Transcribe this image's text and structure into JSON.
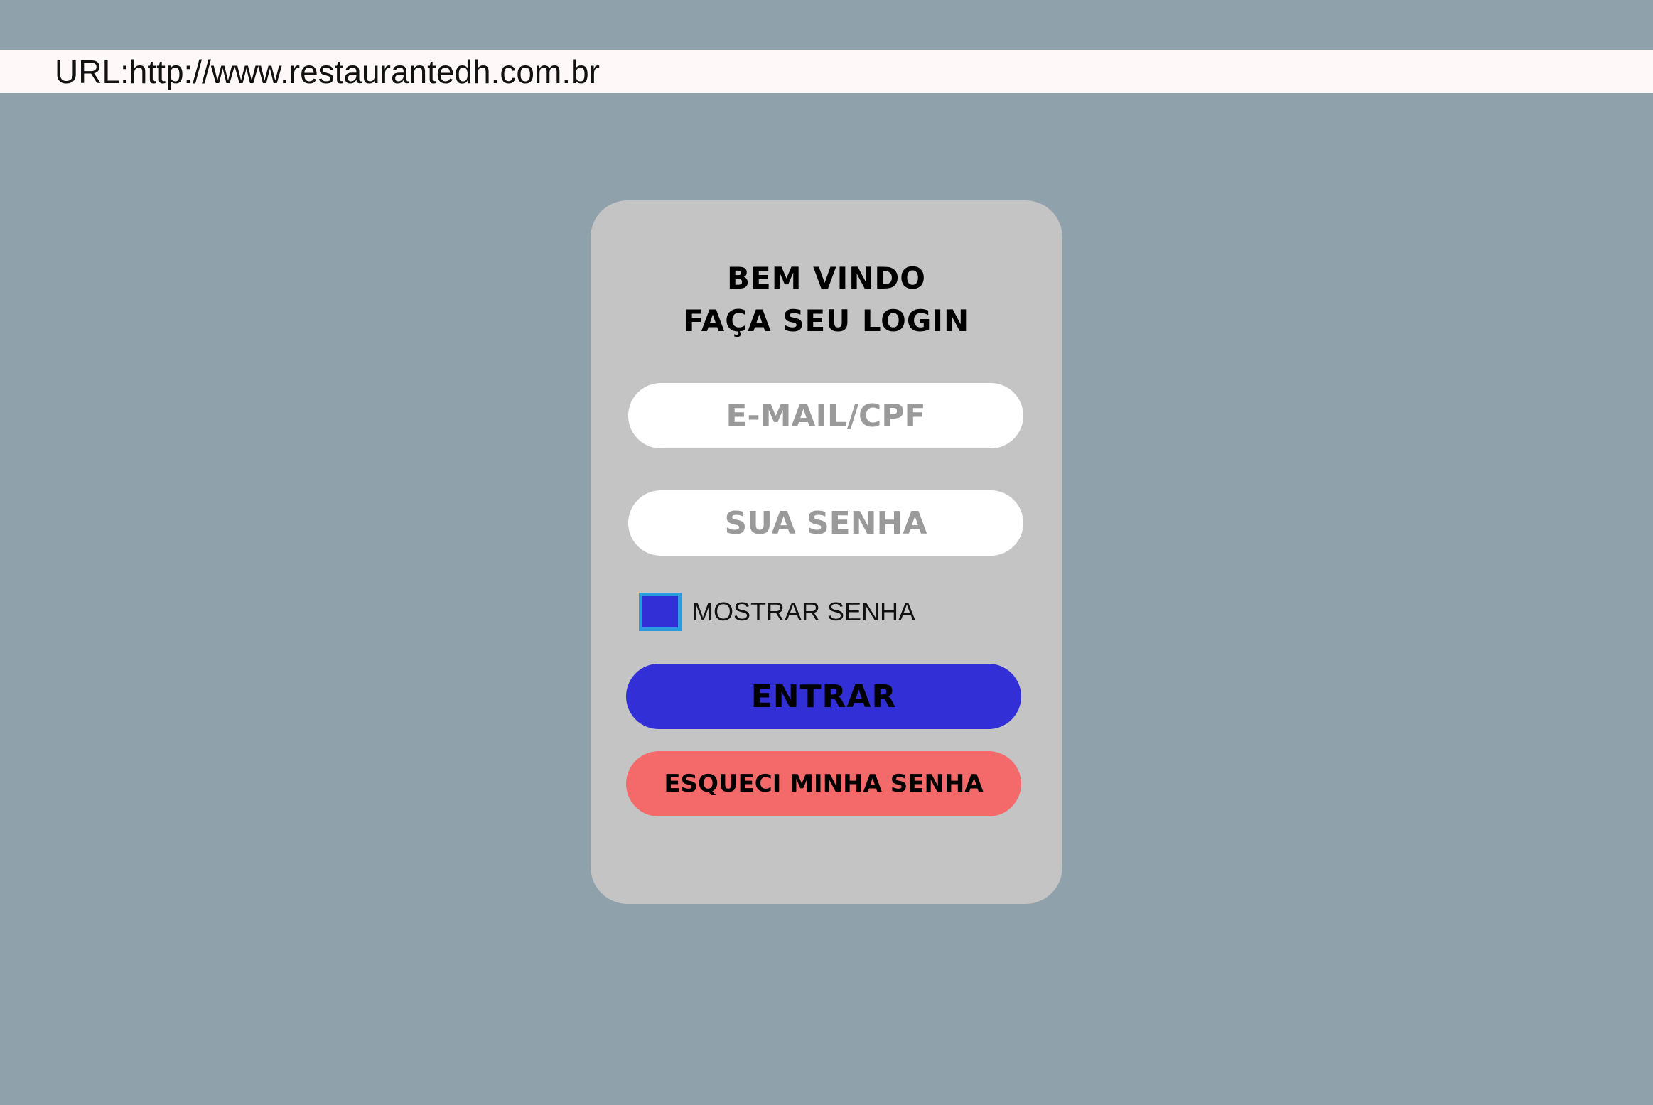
{
  "address_bar": {
    "text": "URL:http://www.restaurantedh.com.br"
  },
  "login_card": {
    "title_line1": "BEM VINDO",
    "title_line2": "FAÇA SEU LOGIN",
    "email_field": {
      "value": "",
      "placeholder": "E-MAIL/CPF"
    },
    "password_field": {
      "value": "",
      "placeholder": "SUA SENHA"
    },
    "show_password": {
      "label": "MOSTRAR SENHA",
      "checked": false
    },
    "enter_button_label": "ENTRAR",
    "forgot_button_label": "ESQUECI MINHA SENHA"
  },
  "colors": {
    "page_background": "#8fa1ab",
    "card_background": "#c4c4c4",
    "enter_button": "#332fd6",
    "forgot_button": "#f46a6a",
    "checkbox_border": "#2d9adf"
  }
}
